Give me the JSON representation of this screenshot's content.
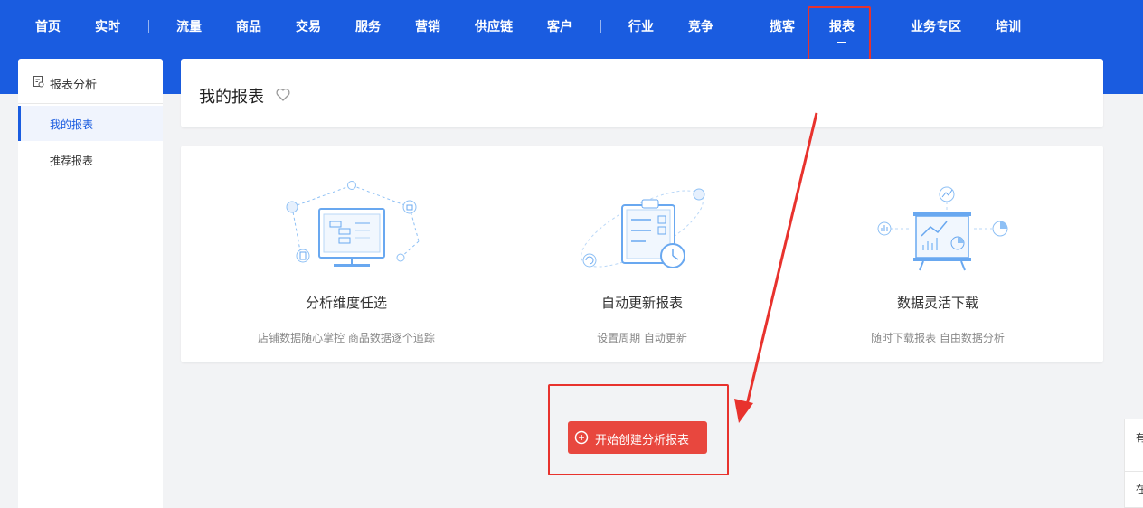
{
  "nav": {
    "items": [
      "首页",
      "实时",
      "流量",
      "商品",
      "交易",
      "服务",
      "营销",
      "供应链",
      "客户",
      "行业",
      "竞争",
      "揽客",
      "报表",
      "业务专区",
      "培训"
    ],
    "active": "报表"
  },
  "sidebar": {
    "header": "报表分析",
    "items": [
      {
        "label": "我的报表",
        "active": true
      },
      {
        "label": "推荐报表",
        "active": false
      }
    ]
  },
  "main": {
    "title": "我的报表",
    "features": [
      {
        "title": "分析维度任选",
        "desc": "店铺数据随心掌控 商品数据逐个追踪"
      },
      {
        "title": "自动更新报表",
        "desc": "设置周期 自动更新"
      },
      {
        "title": "数据灵活下载",
        "desc": "随时下载报表 自由数据分析"
      }
    ],
    "create_button": "开始创建分析报表"
  },
  "right_float": {
    "items": [
      "有调",
      "在咨"
    ]
  },
  "colors": {
    "brand_blue": "#1a5ce0",
    "annotation_red": "#e8322d",
    "button_red": "#e8473e",
    "illustration_blue": "#69a8f0"
  },
  "icons": [
    "report-icon",
    "heart-icon",
    "plus-circle-icon",
    "monitor-chart-icon",
    "clipboard-clock-icon",
    "presentation-board-icon"
  ]
}
